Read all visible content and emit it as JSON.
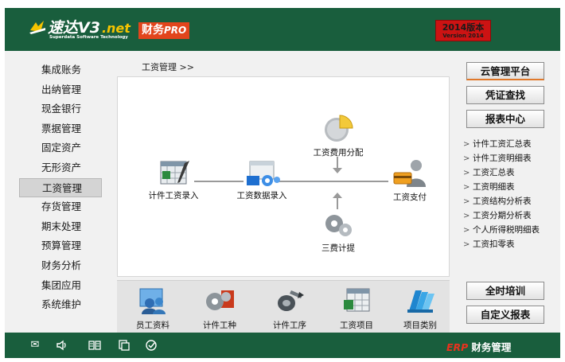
{
  "header": {
    "logo_text": "速达V3",
    "logo_net": ".net",
    "logo_sub": "Superdata Software Technology",
    "product_label": "财务",
    "product_suffix": "PRO",
    "version_line1": "2014版本",
    "version_line2": "Version 2014"
  },
  "breadcrumb": "工资管理  >>",
  "sidebar": {
    "items": [
      {
        "label": "集成账务"
      },
      {
        "label": "出纳管理"
      },
      {
        "label": "现金银行"
      },
      {
        "label": "票据管理"
      },
      {
        "label": "固定资产"
      },
      {
        "label": "无形资产"
      },
      {
        "label": "工资管理",
        "active": true
      },
      {
        "label": "存货管理"
      },
      {
        "label": "期末处理"
      },
      {
        "label": "预算管理"
      },
      {
        "label": "财务分析"
      },
      {
        "label": "集团应用"
      },
      {
        "label": "系统维护"
      }
    ]
  },
  "flow": {
    "piece_wage_entry": "计件工资录入",
    "wage_data_entry": "工资数据录入",
    "wage_cost_allocation": "工资费用分配",
    "wage_payment": "工资支付",
    "three_fee_accrual": "三费计提"
  },
  "tools": [
    {
      "label": "员工资料",
      "icon": "employees-icon"
    },
    {
      "label": "计件工种",
      "icon": "gears-icon"
    },
    {
      "label": "计件工序",
      "icon": "process-icon"
    },
    {
      "label": "工资项目",
      "icon": "spreadsheet-icon"
    },
    {
      "label": "项目类别",
      "icon": "folders-icon"
    }
  ],
  "right": {
    "cloud_button": "云管理平台",
    "voucher_button": "凭证查找",
    "report_center_button": "报表中心",
    "reports": [
      "计件工资汇总表",
      "计件工资明细表",
      "工资汇总表",
      "工资明细表",
      "工资结构分析表",
      "工资分期分析表",
      "个人所得税明细表",
      "工资扣零表"
    ],
    "training_button": "全时培训",
    "custom_report_button": "自定义报表"
  },
  "footer": {
    "erp_prefix": "ERP",
    "erp_label": "财务管理",
    "icons": [
      "mail-icon",
      "speaker-icon",
      "book-icon",
      "copy-icon",
      "check-icon"
    ]
  },
  "colors": {
    "header_green": "#195e3d",
    "accent_orange": "#e2451c",
    "version_red": "#cc1313",
    "logo_yellow": "#f5c400"
  }
}
